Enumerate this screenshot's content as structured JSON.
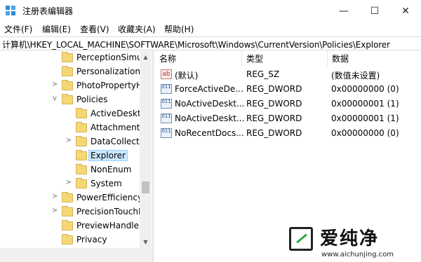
{
  "window": {
    "title": "注册表编辑器",
    "minimize_glyph": "—",
    "maximize_glyph": "☐",
    "close_glyph": "✕"
  },
  "menu": [
    "文件(F)",
    "编辑(E)",
    "查看(V)",
    "收藏夹(A)",
    "帮助(H)"
  ],
  "address": "计算机\\HKEY_LOCAL_MACHINE\\SOFTWARE\\Microsoft\\Windows\\CurrentVersion\\Policies\\Explorer",
  "tree": [
    {
      "label": "PerceptionSimu",
      "expander": ""
    },
    {
      "label": "Personalization",
      "expander": ""
    },
    {
      "label": "PhotoPropertyH",
      "expander": ">"
    },
    {
      "label": "Policies",
      "expander": "v"
    },
    {
      "label": "ActiveDesktop",
      "expander": ""
    },
    {
      "label": "Attachments",
      "expander": ""
    },
    {
      "label": "DataCollection",
      "expander": ">"
    },
    {
      "label": "Explorer",
      "expander": "",
      "selected": true
    },
    {
      "label": "NonEnum",
      "expander": ""
    },
    {
      "label": "System",
      "expander": ">"
    },
    {
      "label": "PowerEfficiency",
      "expander": ">"
    },
    {
      "label": "PrecisionTouchI",
      "expander": ">"
    },
    {
      "label": "PreviewHandler",
      "expander": ""
    },
    {
      "label": "Privacy",
      "expander": ""
    }
  ],
  "columns": {
    "name": "名称",
    "type": "类型",
    "data": "数据"
  },
  "values": [
    {
      "icon": "ab",
      "name": "(默认)",
      "type": "REG_SZ",
      "data": "(数值未设置)"
    },
    {
      "icon": "011",
      "name": "ForceActiveDe...",
      "type": "REG_DWORD",
      "data": "0x00000000 (0)"
    },
    {
      "icon": "011",
      "name": "NoActiveDeskt...",
      "type": "REG_DWORD",
      "data": "0x00000001 (1)"
    },
    {
      "icon": "011",
      "name": "NoActiveDeskt...",
      "type": "REG_DWORD",
      "data": "0x00000001 (1)"
    },
    {
      "icon": "011",
      "name": "NoRecentDocs...",
      "type": "REG_DWORD",
      "data": "0x00000000 (0)"
    }
  ],
  "watermark": {
    "brand": "爱纯净",
    "url": "www.aichunjing.com"
  },
  "colors": {
    "accent": "#2a8bd6",
    "selection": "#cce8ff",
    "folder": "#f6d776"
  }
}
